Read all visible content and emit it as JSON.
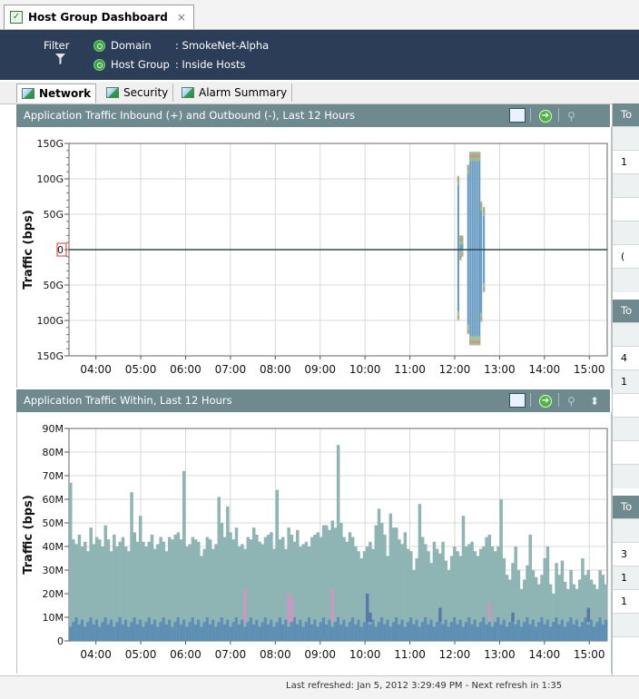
{
  "window": {
    "tab_title": "Host Group Dashboard",
    "close_glyph": "×"
  },
  "filter": {
    "label": "Filter",
    "domain_label": "Domain",
    "domain_value": ": SmokeNet-Alpha",
    "hostgroup_label": "Host Group",
    "hostgroup_value": ": Inside Hosts"
  },
  "tabs": [
    {
      "label": "Network",
      "active": true
    },
    {
      "label": "Security",
      "active": false
    },
    {
      "label": "Alarm Summary",
      "active": false
    }
  ],
  "icons": [
    "filter-icon",
    "search-icon",
    "chart-icon",
    "go-icon",
    "zoom-icon",
    "up-down-icon",
    "check-icon"
  ],
  "colors": {
    "header_bg": "#2b3d57",
    "panel_head": "#6f8a8e",
    "series_main": "#8fb4b4",
    "series_low": "#5d8fb4",
    "series_pink": "#c89ac2",
    "series_blue": "#5a79a9",
    "inbound_bar": "#6d9fc6"
  },
  "right_panel": {
    "sections": [
      {
        "header": "To",
        "rows": [
          "",
          "1",
          "",
          "",
          "",
          "(",
          ""
        ]
      },
      {
        "header": "To",
        "rows": [
          "",
          "4",
          "1",
          "",
          "",
          "",
          ""
        ]
      },
      {
        "header": "To",
        "rows": [
          "",
          "3",
          "1",
          "1",
          "",
          ""
        ]
      }
    ]
  },
  "status": {
    "text": "Last refreshed: Jan 5, 2012 3:29:49 PM - Next refresh in 1:35"
  },
  "chart_data": [
    {
      "type": "bar",
      "title": "Application Traffic Inbound (+) and Outbound (-), Last 12 Hours",
      "ylabel": "Traffic (bps)",
      "ytick_labels": [
        "150G",
        "100G",
        "50G",
        "0",
        "50G",
        "100G",
        "150G"
      ],
      "ylim": [
        -150,
        150
      ],
      "x_ticks": [
        "04:00",
        "05:00",
        "06:00",
        "07:00",
        "08:00",
        "09:00",
        "10:00",
        "11:00",
        "12:00",
        "13:00",
        "14:00",
        "15:00"
      ],
      "x_range": [
        3.4,
        15.4
      ],
      "series": [
        {
          "x": [
            12.08,
            12.13,
            12.17,
            12.21,
            12.3,
            12.35,
            12.4,
            12.45,
            12.5,
            12.55,
            12.59,
            12.65
          ],
          "inbound": [
            104,
            20,
            20,
            0,
            120,
            138,
            138,
            138,
            138,
            138,
            68,
            60
          ],
          "outbound": [
            100,
            15,
            10,
            0,
            119,
            135,
            135,
            135,
            135,
            135,
            102,
            60
          ]
        }
      ],
      "grid": true
    },
    {
      "type": "bar",
      "title": "Application Traffic Within, Last 12 Hours",
      "ylabel": "Traffic (bps)",
      "ytick_labels": [
        "0",
        "10M",
        "20M",
        "30M",
        "40M",
        "50M",
        "60M",
        "70M",
        "80M",
        "90M"
      ],
      "ylim": [
        0,
        90
      ],
      "x_ticks": [
        "04:00",
        "05:00",
        "06:00",
        "07:00",
        "08:00",
        "09:00",
        "10:00",
        "11:00",
        "12:00",
        "13:00",
        "14:00",
        "15:00"
      ],
      "x_range": [
        3.4,
        15.4
      ],
      "series": [
        {
          "name": "",
          "values": [
            67,
            43,
            41,
            45,
            40,
            42,
            38,
            48,
            41,
            44,
            43,
            40,
            49,
            43,
            38,
            45,
            40,
            42,
            44,
            40,
            38,
            63,
            46,
            42,
            53,
            42,
            40,
            42,
            45,
            39,
            41,
            44,
            42,
            38,
            44,
            43,
            45,
            46,
            43,
            72,
            40,
            41,
            44,
            43,
            42,
            36,
            39,
            44,
            43,
            39,
            41,
            61,
            50,
            44,
            57,
            46,
            43,
            48,
            40,
            41,
            39,
            44,
            43,
            48,
            45,
            42,
            41,
            44,
            45,
            46,
            39,
            64,
            43,
            44,
            39,
            48,
            45,
            42,
            47,
            40,
            41,
            42,
            40,
            44,
            45,
            46,
            44,
            49,
            49,
            47,
            51,
            48,
            83,
            50,
            44,
            42,
            46,
            44,
            40,
            38,
            35,
            38,
            40,
            42,
            39,
            49,
            56,
            50,
            45,
            36,
            54,
            48,
            48,
            43,
            41,
            46,
            39,
            38,
            30,
            35,
            58,
            44,
            41,
            38,
            33,
            42,
            39,
            37,
            42,
            34,
            30,
            36,
            40,
            38,
            36,
            53,
            40,
            41,
            42,
            38,
            36,
            39,
            40,
            44,
            45,
            40,
            38,
            40,
            60,
            35,
            28,
            26,
            33,
            40,
            30,
            22,
            26,
            32,
            45,
            30,
            27,
            24,
            28,
            35,
            40,
            24,
            20,
            33,
            28,
            34,
            25,
            22,
            30,
            24,
            22,
            26,
            35,
            28,
            30,
            26,
            24,
            22,
            30,
            28,
            24
          ]
        }
      ],
      "grid": true
    }
  ]
}
